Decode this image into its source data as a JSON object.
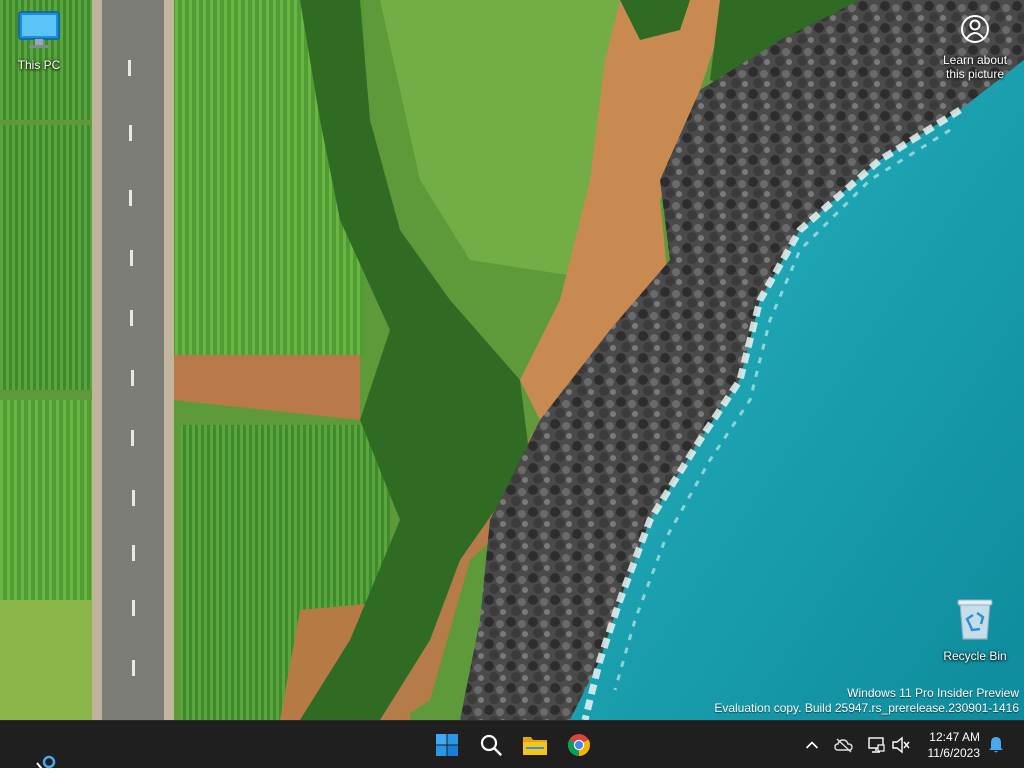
{
  "desktop": {
    "icons": [
      {
        "label": "This PC",
        "icon": "monitor-icon"
      },
      {
        "label": "Recycle Bin",
        "icon": "recycle-bin-icon"
      }
    ],
    "spotlight": {
      "label_line1": "Learn about",
      "label_line2": "this picture",
      "icon": "camera-person-icon"
    },
    "watermark": {
      "line1": "Windows 11 Pro Insider Preview",
      "line2": "Evaluation copy. Build 25947.rs_prerelease.230901-1416"
    }
  },
  "taskbar": {
    "pinned": [
      {
        "name": "Start",
        "icon": "windows-logo-icon"
      },
      {
        "name": "Search",
        "icon": "search-icon"
      },
      {
        "name": "File Explorer",
        "icon": "folder-icon"
      },
      {
        "name": "Google Chrome",
        "icon": "chrome-icon"
      }
    ],
    "tray": {
      "icons": [
        "chevron-up-icon",
        "onedrive-offline-icon",
        "network-icon",
        "volume-muted-icon",
        "notification-bell-icon"
      ]
    },
    "clock": {
      "time": "12:47 AM",
      "date": "11/6/2023"
    }
  },
  "colors": {
    "taskbar_bg": "#1f1f1f",
    "windows_blue": "#0078d4",
    "folder_yellow": "#f7c21a",
    "sea": "#1fa3b0"
  }
}
